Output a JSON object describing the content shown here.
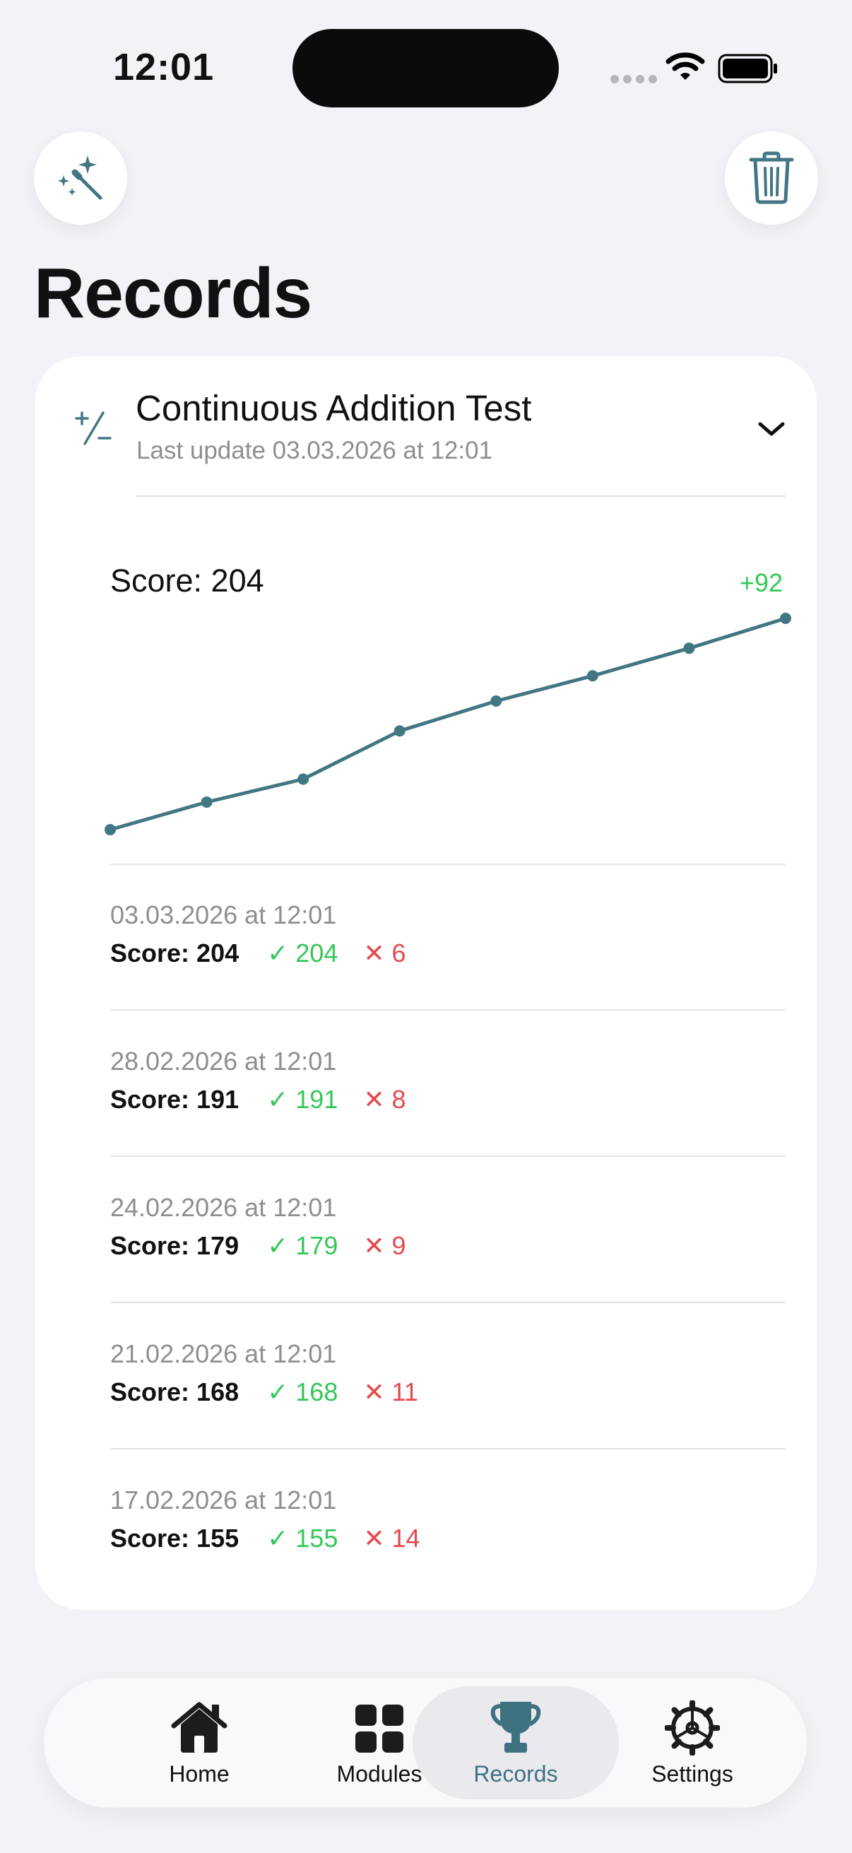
{
  "status_bar": {
    "time": "12:01"
  },
  "page": {
    "title": "Records"
  },
  "card": {
    "title": "Continuous Addition Test",
    "subtitle": "Last update 03.03.2026 at 12:01",
    "chart_score_label": "Score: 204",
    "chart_delta_label": "+92"
  },
  "records": [
    {
      "date": "03.03.2026 at 12:01",
      "score": "Score: 204",
      "correct": "✓ 204",
      "wrong": "✕ 6"
    },
    {
      "date": "28.02.2026 at 12:01",
      "score": "Score: 191",
      "correct": "✓ 191",
      "wrong": "✕ 8"
    },
    {
      "date": "24.02.2026 at 12:01",
      "score": "Score: 179",
      "correct": "✓ 179",
      "wrong": "✕ 9"
    },
    {
      "date": "21.02.2026 at 12:01",
      "score": "Score: 168",
      "correct": "✓ 168",
      "wrong": "✕ 11"
    },
    {
      "date": "17.02.2026 at 12:01",
      "score": "Score: 155",
      "correct": "✓ 155",
      "wrong": "✕ 14"
    }
  ],
  "chart_data": {
    "type": "line",
    "x": [
      "",
      "",
      "",
      "17.02.2026",
      "21.02.2026",
      "24.02.2026",
      "28.02.2026",
      "03.03.2026"
    ],
    "series": [
      {
        "values": [
          112,
          124,
          134,
          155,
          168,
          179,
          191,
          204
        ]
      }
    ],
    "line_color": "#427683"
  },
  "tabs": [
    {
      "label": "Home",
      "icon": "house-icon",
      "selected": false
    },
    {
      "label": "Modules",
      "icon": "grid-icon",
      "selected": false
    },
    {
      "label": "Records",
      "icon": "trophy-icon",
      "selected": true
    },
    {
      "label": "Settings",
      "icon": "gear-icon",
      "selected": false
    }
  ],
  "colors": {
    "accent": "#427683",
    "success": "#34c759",
    "error": "#e5484d",
    "background": "#f2f2f7"
  }
}
